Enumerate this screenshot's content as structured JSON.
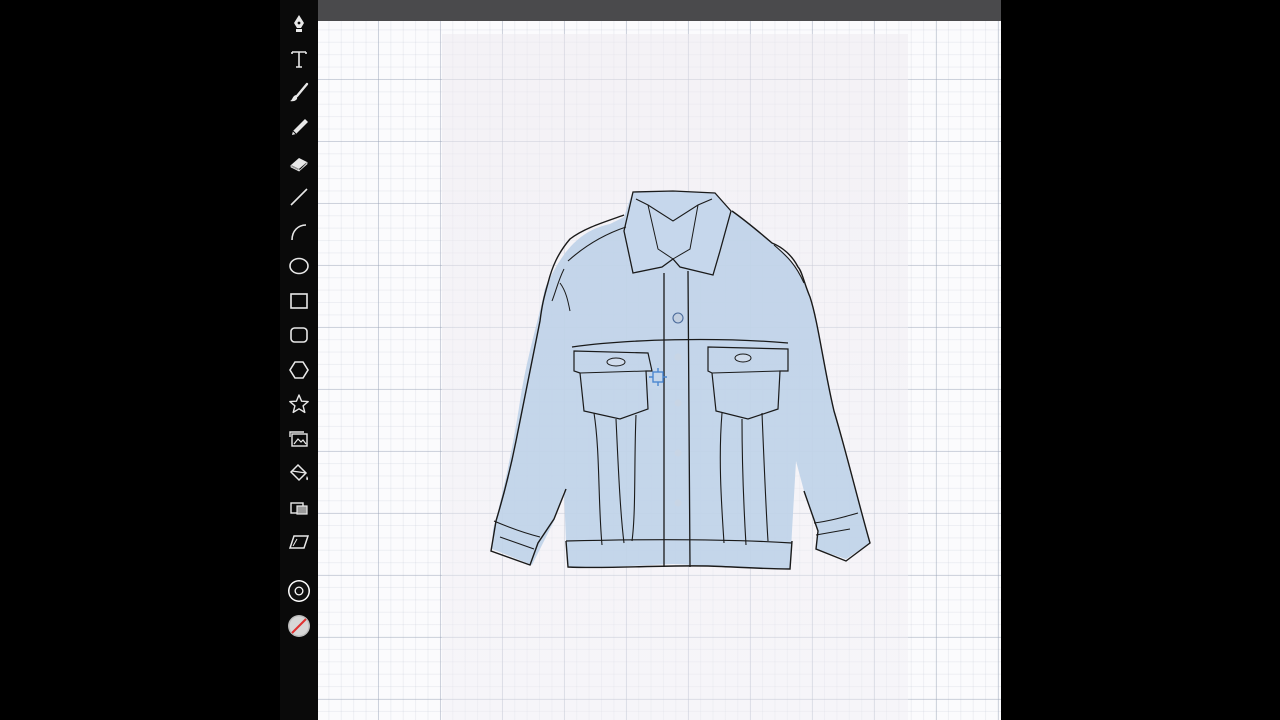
{
  "toolbar": {
    "tools": [
      {
        "name": "pen-tool",
        "icon": "pen-nib-icon"
      },
      {
        "name": "text-tool",
        "icon": "text-t-icon"
      },
      {
        "name": "brush-tool",
        "icon": "brush-icon"
      },
      {
        "name": "pencil-tool",
        "icon": "pencil-icon"
      },
      {
        "name": "eraser-tool",
        "icon": "eraser-icon"
      },
      {
        "name": "line-tool",
        "icon": "line-icon"
      },
      {
        "name": "arc-tool",
        "icon": "arc-icon"
      },
      {
        "name": "ellipse-tool",
        "icon": "ellipse-icon"
      },
      {
        "name": "rectangle-tool",
        "icon": "rectangle-icon"
      },
      {
        "name": "rounded-rectangle-tool",
        "icon": "rounded-rectangle-icon"
      },
      {
        "name": "polygon-tool",
        "icon": "hexagon-icon"
      },
      {
        "name": "star-tool",
        "icon": "star-icon"
      },
      {
        "name": "image-tool",
        "icon": "image-stack-icon"
      },
      {
        "name": "fill-tool",
        "icon": "paint-bucket-icon"
      },
      {
        "name": "arrange-tool",
        "icon": "arrange-layers-icon"
      },
      {
        "name": "shear-tool",
        "icon": "parallelogram-icon"
      }
    ],
    "stroke_color": "#111111",
    "fill_color": "none"
  },
  "colors": {
    "toolbar_bg": "#0a0a0a",
    "topbar_bg": "#4a4a4c",
    "canvas_bg": "#fbfbfd",
    "denim": "#bcd0e6",
    "outline": "#1a1a1a"
  }
}
